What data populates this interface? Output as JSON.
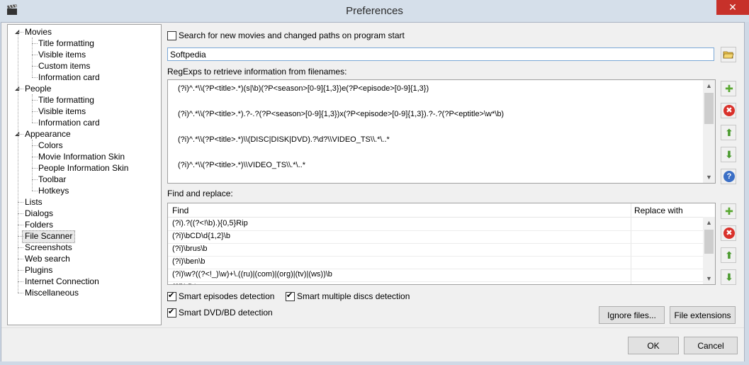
{
  "window": {
    "title": "Preferences",
    "close_glyph": "✕"
  },
  "tree": {
    "items": [
      {
        "label": "Movies",
        "level": 0,
        "expanded": true
      },
      {
        "label": "Title formatting",
        "level": 1
      },
      {
        "label": "Visible items",
        "level": 1
      },
      {
        "label": "Custom items",
        "level": 1
      },
      {
        "label": "Information card",
        "level": 1
      },
      {
        "label": "People",
        "level": 0,
        "expanded": true
      },
      {
        "label": "Title formatting",
        "level": 1
      },
      {
        "label": "Visible items",
        "level": 1
      },
      {
        "label": "Information card",
        "level": 1
      },
      {
        "label": "Appearance",
        "level": 0,
        "expanded": true
      },
      {
        "label": "Colors",
        "level": 1
      },
      {
        "label": "Movie Information Skin",
        "level": 1
      },
      {
        "label": "People Information Skin",
        "level": 1
      },
      {
        "label": "Toolbar",
        "level": 1
      },
      {
        "label": "Hotkeys",
        "level": 1
      },
      {
        "label": "Lists",
        "level": 0
      },
      {
        "label": "Dialogs",
        "level": 0
      },
      {
        "label": "Folders",
        "level": 0
      },
      {
        "label": "File Scanner",
        "level": 0,
        "selected": true
      },
      {
        "label": "Screenshots",
        "level": 0
      },
      {
        "label": "Web search",
        "level": 0
      },
      {
        "label": "Plugins",
        "level": 0
      },
      {
        "label": "Internet Connection",
        "level": 0
      },
      {
        "label": "Miscellaneous",
        "level": 0
      }
    ]
  },
  "scanner": {
    "search_new_label": "Search for new movies and changed paths on program start",
    "search_new_checked": false,
    "path_value": "Softpedia",
    "regexps_label": "RegExps to retrieve information from filenames:",
    "regexps": [
      "(?i)^.*\\\\(?P<title>.*)(s|\\b)(?P<season>[0-9]{1,3})e(?P<episode>[0-9]{1,3})",
      "(?i)^.*\\\\(?P<title>.*).?-.?(?P<season>[0-9]{1,3})x(?P<episode>[0-9]{1,3}).?-.?(?P<eptitle>\\w*\\b)",
      "(?i)^.*\\\\(?P<title>.*)\\\\(DISC|DISK|DVD).?\\d?\\\\VIDEO_TS\\\\.*\\..*",
      "(?i)^.*\\\\(?P<title>.*)\\\\VIDEO_TS\\\\.*\\..*"
    ],
    "find_replace_label": "Find and replace:",
    "find_header": "Find",
    "replace_header": "Replace with",
    "find_rows": [
      "(?i).?((?<!\\b).){0,5}Rip",
      "(?i)\\bCD\\d{1,2}\\b",
      "(?i)\\brus\\b",
      "(?i)\\ben\\b",
      "(?i)\\w?((?<!_)\\w)+\\.((ru)|(com)|(org)|(tv)|(ws))\\b",
      "(?i)LD*"
    ],
    "smart_episodes_label": "Smart episodes detection",
    "smart_episodes_checked": true,
    "smart_multi_label": "Smart multiple discs detection",
    "smart_multi_checked": true,
    "smart_dvd_label": "Smart DVD/BD detection",
    "smart_dvd_checked": true,
    "ignore_files_label": "Ignore files...",
    "file_ext_label": "File extensions"
  },
  "footer": {
    "ok_label": "OK",
    "cancel_label": "Cancel"
  },
  "colors": {
    "add": "#5aa832",
    "remove": "#d9312b",
    "arrow": "#4a9a2e",
    "help": "#3b6fc6"
  },
  "icons": {
    "add": "plus-icon",
    "remove": "remove-icon",
    "up": "arrow-up-icon",
    "down": "arrow-down-icon",
    "help": "help-icon",
    "folder": "folder-icon"
  }
}
